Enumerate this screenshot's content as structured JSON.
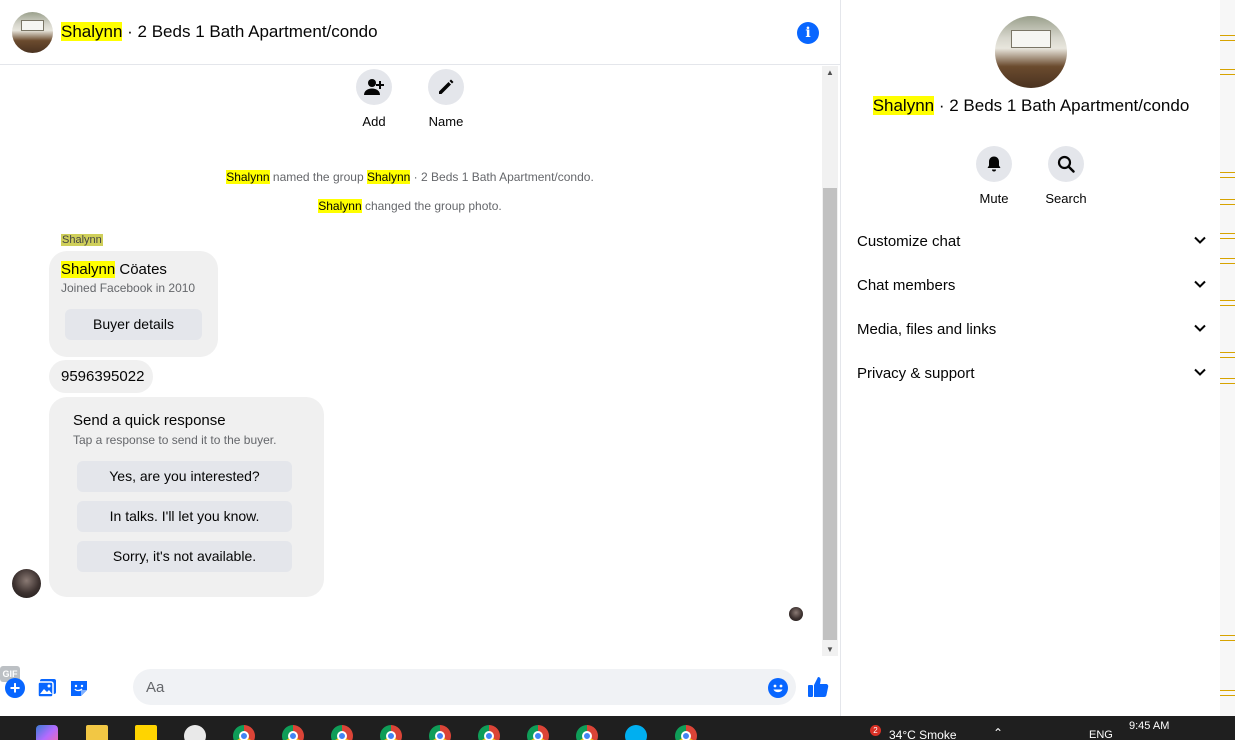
{
  "header": {
    "title_highlight": "Shalynn",
    "title_rest": " · 2 Beds 1 Bath Apartment/condo"
  },
  "actions": {
    "add_label": "Add",
    "name_label": "Name"
  },
  "system_messages": {
    "named_prefix": "Shalynn",
    "named_middle": " named the group ",
    "named_group_highlight": "Shalynn",
    "named_group_rest": " · 2 Beds 1 Bath Apartment/condo.",
    "photo_prefix": "Shalynn",
    "photo_rest": " changed the group photo."
  },
  "messages": {
    "sender_label": "Shalynn",
    "card": {
      "name_highlight": "Shalynn",
      "name_rest": " Cöates",
      "subtitle": "Joined Facebook in 2010",
      "button": "Buyer details"
    },
    "phone": "9596395022",
    "quick_response": {
      "title": "Send a quick response",
      "subtitle": "Tap a response to send it to the buyer.",
      "options": [
        "Yes, are you interested?",
        "In talks. I'll let you know.",
        "Sorry, it's not available."
      ]
    }
  },
  "composer": {
    "placeholder": "Aa",
    "gif_label": "GIF"
  },
  "info_pane": {
    "title_highlight": "Shalynn",
    "title_rest": " · 2 Beds 1 Bath Apartment/condo",
    "mute_label": "Mute",
    "search_label": "Search",
    "menu": [
      "Customize chat",
      "Chat members",
      "Media, files and links",
      "Privacy & support"
    ]
  },
  "taskbar": {
    "notification_count": "2",
    "weather": "34°C  Smoke",
    "language": "ENG",
    "time": "9:45 AM"
  },
  "colors": {
    "accent": "#0866ff",
    "highlight": "#ffff00",
    "bubble": "#f0f0f0"
  }
}
